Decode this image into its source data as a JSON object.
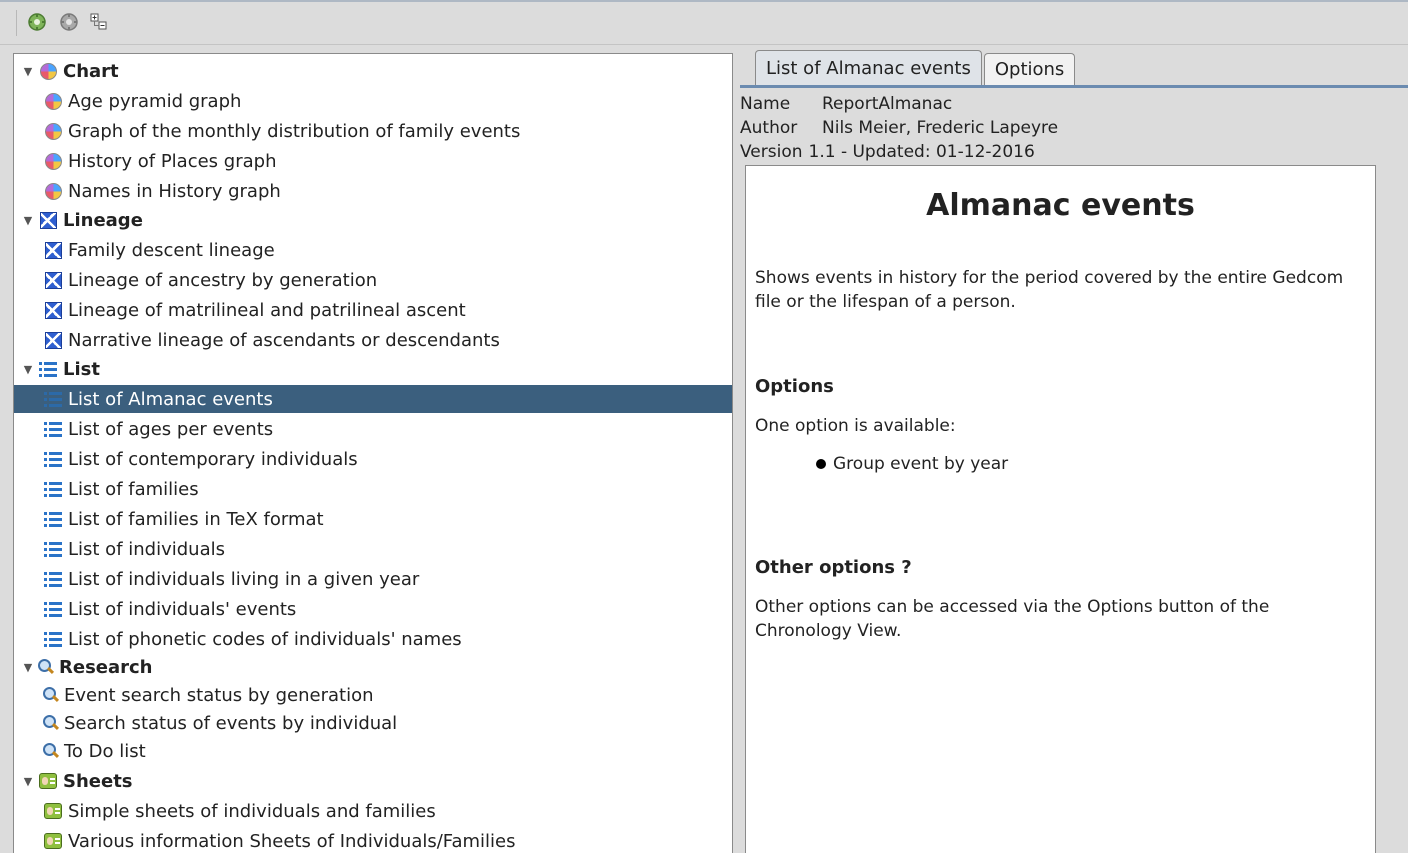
{
  "toolbar": {
    "buttons": [
      "run-report-icon",
      "stop-report-icon",
      "expand-collapse-icon"
    ]
  },
  "tree": {
    "categories": [
      {
        "label": "Chart",
        "icon": "chart-pie-icon",
        "items": [
          "Age pyramid graph",
          "Graph of the monthly distribution of family events",
          "History of Places graph",
          "Names in History graph"
        ]
      },
      {
        "label": "Lineage",
        "icon": "lineage-icon",
        "items": [
          "Family descent lineage",
          "Lineage of ancestry by generation",
          "Lineage of matrilineal and patrilineal ascent",
          "Narrative lineage of ascendants or descendants"
        ]
      },
      {
        "label": "List",
        "icon": "list-icon",
        "items": [
          "List of Almanac events",
          "List of ages per events",
          "List of contemporary individuals",
          "List of families",
          "List of families in TeX format",
          "List of individuals",
          "List of individuals living in a given year",
          "List of individuals' events",
          "List of phonetic codes of individuals' names"
        ],
        "selected": "List of Almanac events"
      },
      {
        "label": "Research",
        "icon": "search-icon",
        "items": [
          "Event search status by generation",
          "Search status of events by individual",
          "To Do list"
        ]
      },
      {
        "label": "Sheets",
        "icon": "sheet-icon",
        "items": [
          "Simple sheets of individuals and families",
          "Various information Sheets of Individuals/Families"
        ]
      }
    ]
  },
  "tabs": {
    "active": "List of Almanac events",
    "other": "Options"
  },
  "meta": {
    "name_label": "Name",
    "name_value": "ReportAlmanac",
    "author_label": "Author",
    "author_value": "Nils Meier, Frederic Lapeyre",
    "version_label": "Version",
    "version_value": "1.1 - Updated: 01-12-2016"
  },
  "doc": {
    "title": "Almanac events",
    "description": "Shows events in history for the period covered by the entire Gedcom file or the lifespan of a person.",
    "options_heading": "Options",
    "options_text": "One option is available:",
    "option_item": "Group event by year",
    "other_heading": "Other options ?",
    "other_text": "Other options can be accessed via the Options button of the Chronology View."
  }
}
